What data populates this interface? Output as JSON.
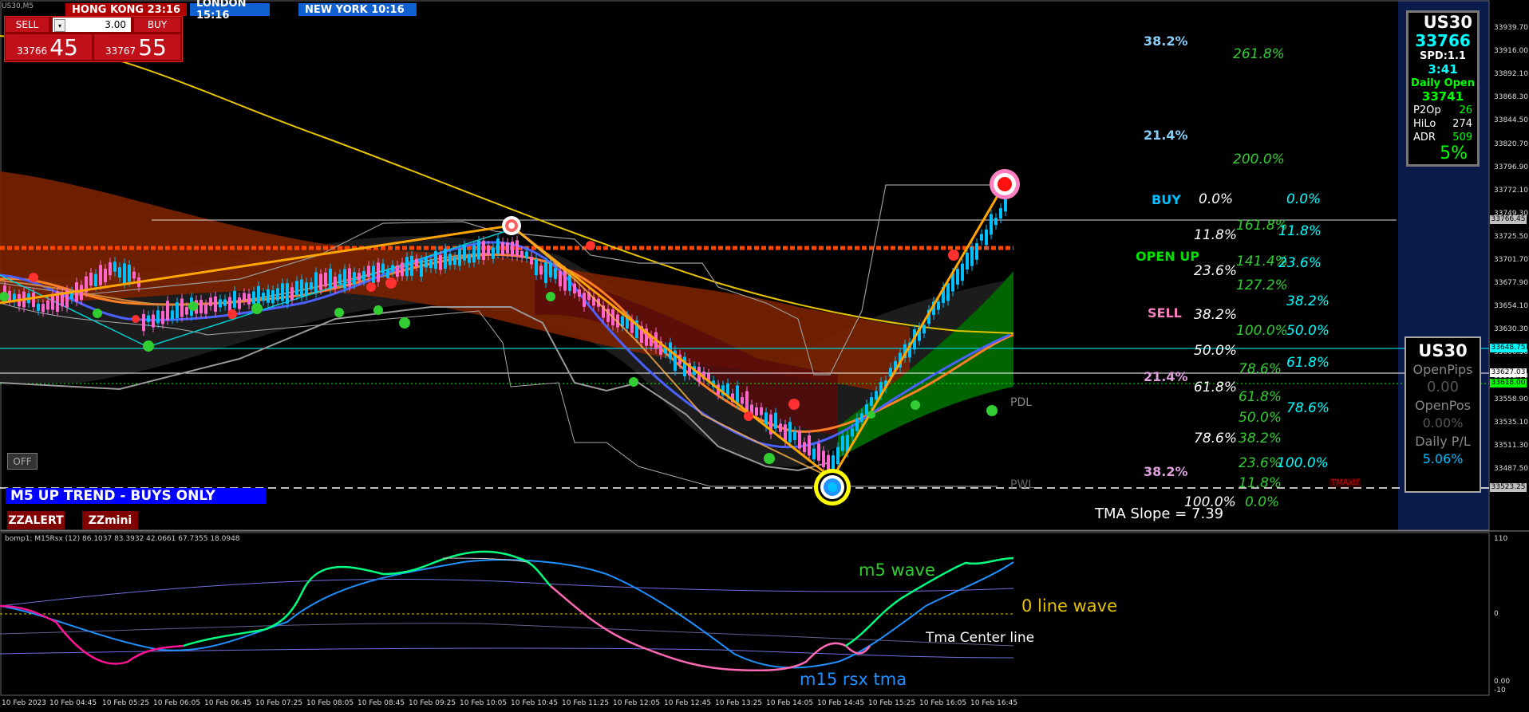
{
  "symbol_tab": "US30,M5",
  "trade_panel": {
    "sell_label": "SELL",
    "buy_label": "BUY",
    "lot_size": "3.00",
    "sell_price_small": "33766",
    "sell_price_big": "45",
    "buy_price_small": "33767",
    "buy_price_big": "55"
  },
  "clocks": [
    {
      "label": "HONG KONG 23:16",
      "color": "#b00000"
    },
    {
      "label": "LONDON  15:16",
      "color": "#1060d0"
    },
    {
      "label": "NEW YORK 10:16",
      "color": "#1060d0"
    }
  ],
  "trend_banner": "M5 UP TREND - BUYS ONLY",
  "zz_buttons": {
    "zzalert": "ZZALERT",
    "zzmini": "ZZmini"
  },
  "off_button": "OFF",
  "tma_slope": "TMA Slope = 7.39",
  "level_labels": {
    "pdl": "PDL",
    "pwl": "PWL",
    "maxtf": "TMAxtf"
  },
  "fib_left": [
    {
      "text": "38.2%",
      "color": "#87cefa"
    },
    {
      "text": "21.4%",
      "color": "#87cefa"
    },
    {
      "text": "BUY",
      "color": "#00bfff"
    },
    {
      "text": "OPEN UP",
      "color": "#00e000"
    },
    {
      "text": "SELL",
      "color": "#ff80c0"
    },
    {
      "text": "21.4%",
      "color": "#dda0dd"
    },
    {
      "text": "38.2%",
      "color": "#dda0dd"
    }
  ],
  "fib_mid": [
    "0.0%",
    "11.8%",
    "23.6%",
    "38.2%",
    "50.0%",
    "61.8%",
    "78.6%",
    "100.0%"
  ],
  "fib_green": [
    "261.8%",
    "200.0%",
    "161.8%",
    "141.4%",
    "127.2%",
    "100.0%",
    "78.6%",
    "61.8%",
    "50.0%",
    "38.2%",
    "23.6%",
    "11.8%",
    "0.0%"
  ],
  "fib_cyan": [
    "0.0%",
    "11.8%",
    "23.6%",
    "38.2%",
    "50.0%",
    "61.8%",
    "78.6%",
    "100.0%"
  ],
  "info_box": {
    "symbol": "US30",
    "price": "33766",
    "spread": "SPD:1.1",
    "timer": "3:41",
    "daily_open_label": "Daily Open",
    "daily_open": "33741",
    "p2op_label": "P2Op",
    "p2op": "26",
    "hilo_label": "HiLo",
    "hilo": "274",
    "adr_label": "ADR",
    "adr": "509",
    "pct": "5%"
  },
  "position_box": {
    "symbol": "US30",
    "open_pips_label": "OpenPips",
    "open_pips": "0.00",
    "open_pos_label": "OpenPos",
    "open_pos": "0.00%",
    "daily_pl_label": "Daily P/L",
    "daily_pl": "5.06%"
  },
  "price_axis": [
    "33939.70",
    "33916.00",
    "33892.10",
    "33868.30",
    "33844.50",
    "33820.70",
    "33796.90",
    "33772.10",
    "33749.30",
    "33725.50",
    "33701.70",
    "33677.90",
    "33654.10",
    "33630.30",
    "33606.50",
    "33582.70",
    "33558.90",
    "33535.10",
    "33511.30",
    "33487.50"
  ],
  "price_highlights": [
    {
      "text": "33766.45",
      "bg": "#c0c0c0"
    },
    {
      "text": "33648.75",
      "bg": "#00ffff"
    },
    {
      "text": "33627.03",
      "bg": "#ffffff"
    },
    {
      "text": "33618.00",
      "bg": "#00ff00"
    },
    {
      "text": "33523.25",
      "bg": "#c0c0c0"
    }
  ],
  "sub_window": {
    "label": "bomp1: M15Rsx (12) 86.1037 83.3932 42.0661 67.7355 18.0948",
    "axis": [
      "110",
      "0",
      "0.00",
      "-10"
    ],
    "annotations": {
      "m5": "m5 wave",
      "zero": "0 line wave",
      "tma": "Tma Center line",
      "m15": "m15 rsx tma"
    }
  },
  "time_axis": [
    "10 Feb 2023",
    "10 Feb 04:45",
    "10 Feb 05:25",
    "10 Feb 06:05",
    "10 Feb 06:45",
    "10 Feb 07:25",
    "10 Feb 08:05",
    "10 Feb 08:45",
    "10 Feb 09:25",
    "10 Feb 10:05",
    "10 Feb 10:45",
    "10 Feb 11:25",
    "10 Feb 12:05",
    "10 Feb 12:45",
    "10 Feb 13:25",
    "10 Feb 14:05",
    "10 Feb 14:45",
    "10 Feb 15:25",
    "10 Feb 16:05",
    "10 Feb 16:45"
  ],
  "colors": {
    "bull_candle": "#00bfff",
    "bear_candle": "#ff66cc",
    "tma_band": "#8b2500",
    "up_channel": "#006400",
    "zigzag": "#ffa500",
    "rsx_up": "#00ff7f",
    "rsx_down": "#ff1493"
  }
}
